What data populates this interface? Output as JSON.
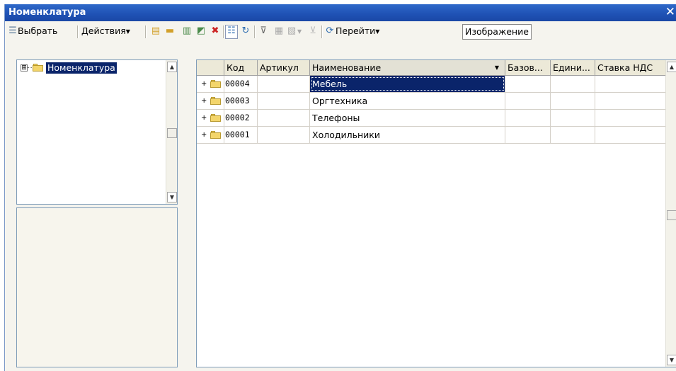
{
  "window": {
    "title": "Номенклатура"
  },
  "toolbar": {
    "select_label": "Выбрать",
    "actions_label": "Действия",
    "goto_label": "Перейти",
    "image_label": "Изображение",
    "dropdown_glyph": "▼"
  },
  "tree": {
    "root_label": "Номенклатура",
    "expand_glyph": "⊞"
  },
  "table": {
    "columns": [
      "Код",
      "Артикул",
      "Наименование",
      "Базов...",
      "Едини...",
      "Ставка НДС"
    ],
    "rows": [
      {
        "code": "00004",
        "article": "",
        "name": "Мебель"
      },
      {
        "code": "00003",
        "article": "",
        "name": "Оргтехника"
      },
      {
        "code": "00002",
        "article": "",
        "name": "Телефоны"
      },
      {
        "code": "00001",
        "article": "",
        "name": "Холодильники"
      }
    ],
    "sort_glyph": "▼",
    "row_marker": "+"
  },
  "colors": {
    "titlebar": "#1f51b4",
    "selection": "#0a246a",
    "folder": "#f3d56b"
  },
  "icons": [
    "select-icon",
    "add-icon",
    "add-group-icon",
    "copy-icon",
    "hierarchy-icon",
    "delete-mark-icon",
    "tree-mode-icon",
    "refresh-icon",
    "filter-icon",
    "filter-list-icon",
    "history-icon",
    "clear-filter-icon",
    "goto-icon",
    "close-icon"
  ]
}
